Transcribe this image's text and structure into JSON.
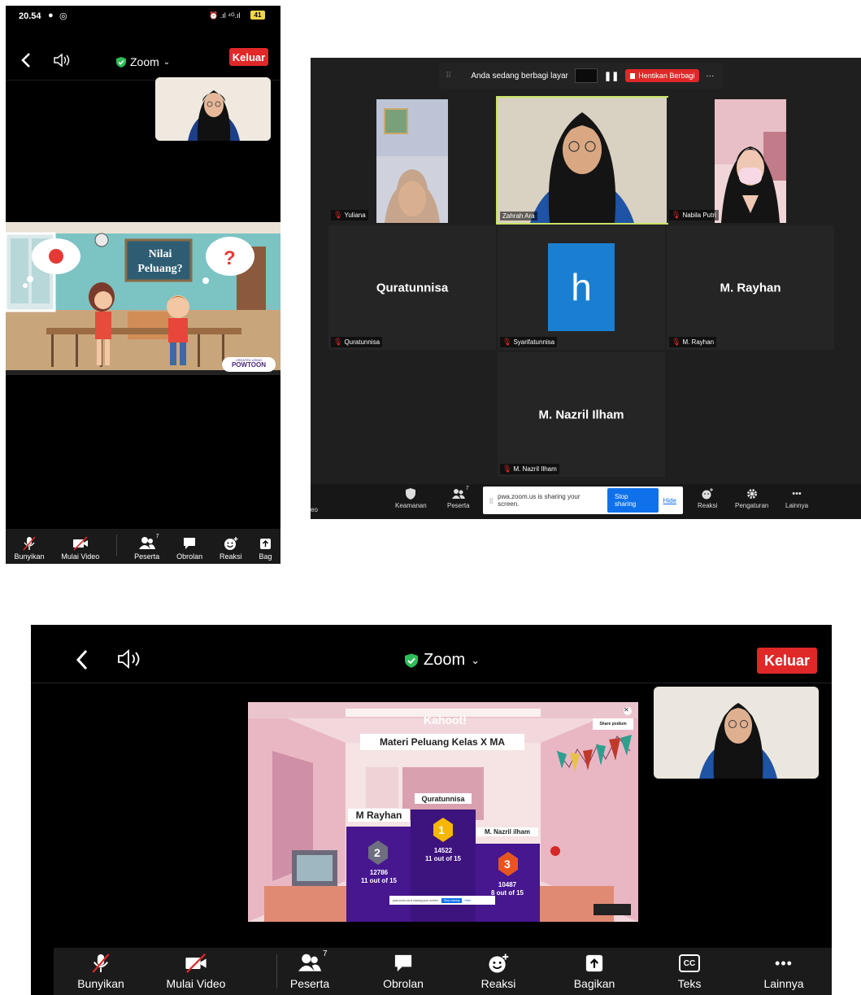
{
  "phone": {
    "status": {
      "time": "20.54",
      "icons_right": "⏰ .ıl ⁴ᴳ.ıl",
      "battery": "41"
    },
    "nav": {
      "title": "Zoom",
      "leave": "Keluar"
    },
    "cartoon": {
      "board_line1": "Nilai",
      "board_line2": "Peluang?",
      "badge_small": "CREATED USING",
      "badge": "POWTOON"
    },
    "toolbar": [
      {
        "label": "Bunyikan",
        "icon": "mic-off-icon"
      },
      {
        "label": "Mulai Video",
        "icon": "video-off-icon"
      },
      {
        "label": "Peserta",
        "icon": "participants-icon",
        "count": "7"
      },
      {
        "label": "Obrolan",
        "icon": "chat-icon"
      },
      {
        "label": "Reaksi",
        "icon": "reaction-icon"
      },
      {
        "label": "Bag",
        "icon": "share-icon"
      }
    ]
  },
  "desktop": {
    "sharebar": {
      "text": "Anda sedang berbagi layar",
      "stop": "Hentikan Berbagi",
      "more": "···"
    },
    "tiles": [
      {
        "name": "Yuliana"
      },
      {
        "name": "Zahrah Ara"
      },
      {
        "name": "Nabila Putri"
      },
      {
        "name": "Quratunnisa",
        "big": "Quratunnisa"
      },
      {
        "name": "Syarifatunnisa",
        "avatar_letter": "h"
      },
      {
        "name": "M. Rayhan",
        "big": "M. Rayhan"
      },
      {
        "name": "M. Nazril Ilham",
        "big": "M. Nazril Ilham"
      }
    ],
    "bottom": {
      "left_cut": "eo",
      "security": "Keamanan",
      "participants": "Peserta",
      "participants_count": "7",
      "reaction": "Reaksi",
      "settings": "Pengaturan",
      "more": "Lainnya"
    },
    "sharing_note": {
      "text": "pwa.zoom.us is sharing your screen.",
      "stop": "Stop sharing",
      "hide": "Hide"
    }
  },
  "tablet": {
    "nav": {
      "title": "Zoom",
      "leave": "Keluar"
    },
    "kahoot": {
      "logo": "Kahoot!",
      "title": "Materi Peluang Kelas X MA",
      "share": "Share podium",
      "sharing_note": "pwa.zoom.us is sharing your screen.",
      "sharing_stop": "Stop sharing",
      "sharing_hide": "Hide",
      "podium": [
        {
          "rank": "1",
          "name": "Quratunnisa",
          "score": "14522",
          "detail": "11 out of 15"
        },
        {
          "rank": "2",
          "name": "M Rayhan",
          "score": "12786",
          "detail": "11 out of 15"
        },
        {
          "rank": "3",
          "name": "M. Nazril ilham",
          "score": "10487",
          "detail": "8 out of 15"
        }
      ]
    },
    "toolbar": [
      {
        "label": "Bunyikan",
        "icon": "mic-off-icon"
      },
      {
        "label": "Mulai Video",
        "icon": "video-off-icon"
      },
      {
        "label": "Peserta",
        "icon": "participants-icon",
        "count": "7"
      },
      {
        "label": "Obrolan",
        "icon": "chat-icon"
      },
      {
        "label": "Reaksi",
        "icon": "reaction-icon"
      },
      {
        "label": "Bagikan",
        "icon": "share-icon"
      },
      {
        "label": "Teks",
        "icon": "cc-icon",
        "badge": "CC"
      },
      {
        "label": "Lainnya",
        "icon": "more-icon"
      }
    ]
  },
  "colors": {
    "leave_red": "#e02828",
    "shield_green": "#2ebd59",
    "zoom_blue": "#0e71eb",
    "kahoot_purple": "#46178f",
    "active_speaker": "#c9e265"
  }
}
